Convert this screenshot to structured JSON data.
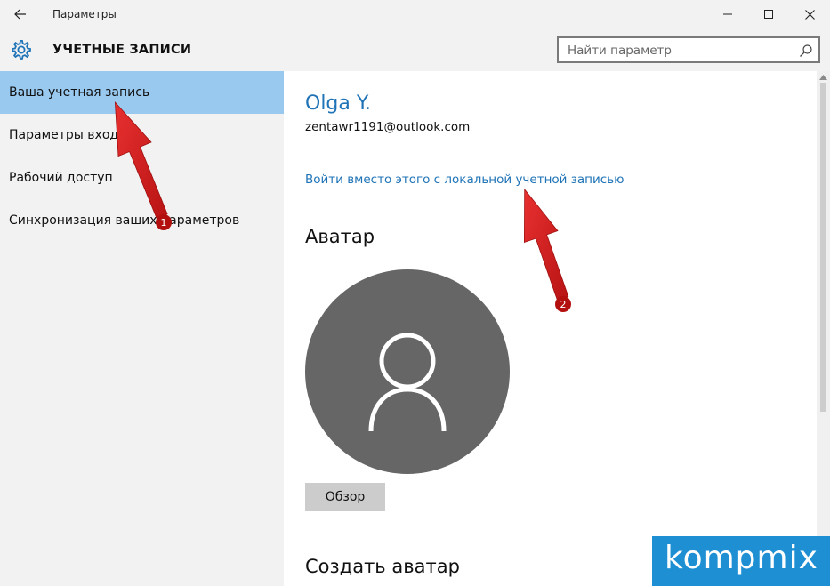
{
  "window": {
    "title": "Параметры"
  },
  "header": {
    "title": "УЧЕТНЫЕ ЗАПИСИ",
    "search_placeholder": "Найти параметр"
  },
  "sidebar": {
    "items": [
      {
        "label": "Ваша учетная запись",
        "active": true
      },
      {
        "label": "Параметры входа",
        "active": false
      },
      {
        "label": "Рабочий доступ",
        "active": false
      },
      {
        "label": "Синхронизация ваших параметров",
        "active": false
      }
    ]
  },
  "account": {
    "name": "Olga Y.",
    "email": "zentawr1191@outlook.com",
    "local_link": "Войти вместо этого с локальной учетной записью"
  },
  "avatar_section": {
    "heading": "Аватар",
    "browse_label": "Обзор"
  },
  "create_avatar": {
    "heading": "Создать аватар"
  },
  "annotations": {
    "marker_1": "1",
    "marker_2": "2"
  },
  "watermark": {
    "text": "kompmix"
  },
  "colors": {
    "accent": "#1f73b7",
    "active_nav": "#99c9ef",
    "arrow": "#d81e1e",
    "avatar_bg": "#666666",
    "watermark_bg": "#1f8fd4"
  }
}
